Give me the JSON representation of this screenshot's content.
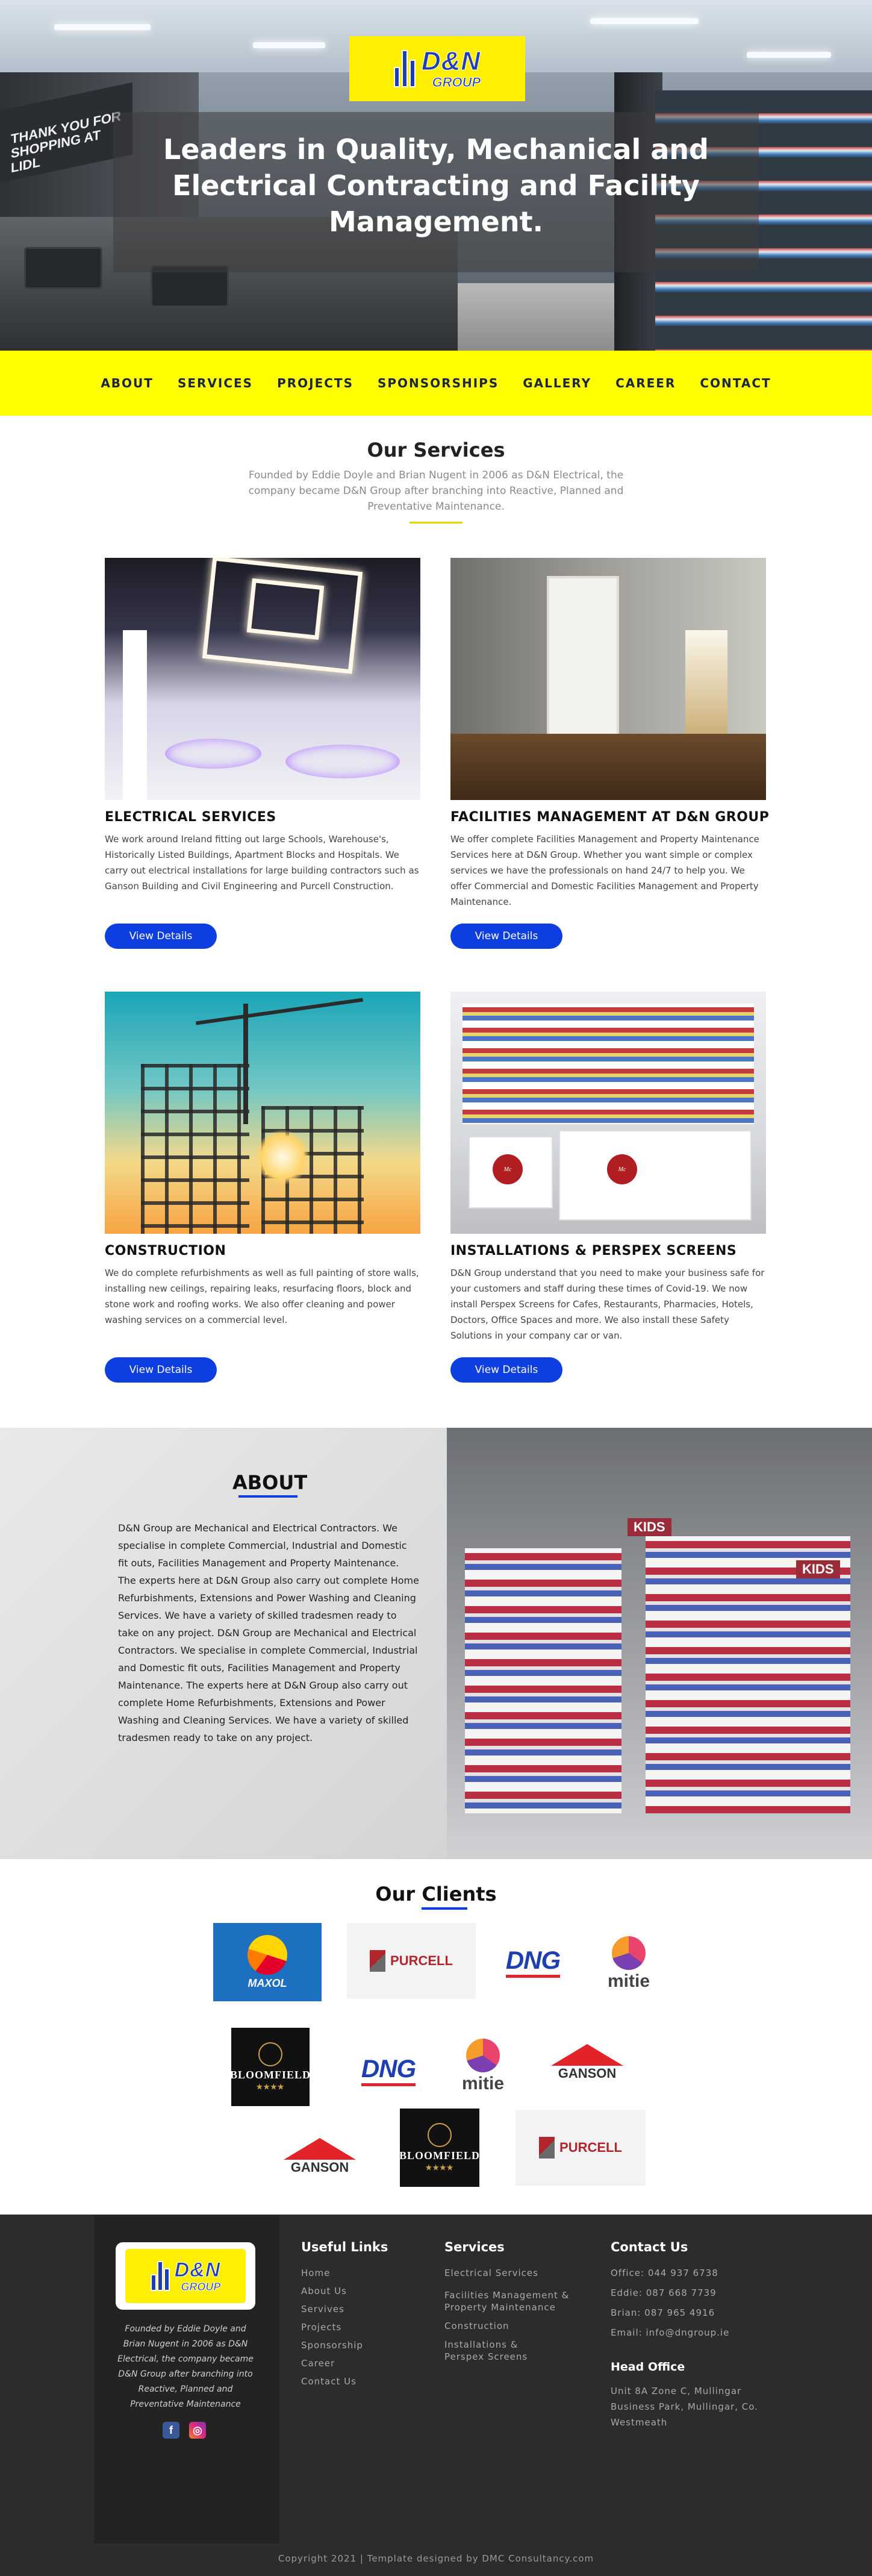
{
  "brand": {
    "logo_main": "D&N",
    "logo_sub": "GROUP",
    "accent": "#ffff00",
    "button_blue": "#0d3fe0"
  },
  "hero": {
    "title": "Leaders in Quality, Mechanical and Electrical Contracting and Facility Management.",
    "sign_text": "THANK YOU FOR SHOPPING AT LIDL"
  },
  "nav": {
    "items": [
      "ABOUT",
      "SERVICES",
      "PROJECTS",
      "SPONSORSHIPS",
      "GALLERY",
      "CAREER",
      "CONTACT"
    ]
  },
  "services": {
    "title": "Our Services",
    "intro": "Founded by Eddie Doyle and Brian Nugent in 2006 as D&N Electrical, the company became D&N Group after branching into Reactive, Planned and Preventative Maintenance.",
    "cards": [
      {
        "title": "ELECTRICAL SERVICES",
        "text": "We work around Ireland fitting out large Schools, Warehouse's, Historically Listed Buildings, Apartment Blocks and Hospitals. We carry out electrical installations for large building contractors such as Ganson Building and Civil Engineering and Purcell Construction.",
        "button": "View Details"
      },
      {
        "title": "FACILITIES MANAGEMENT AT D&N GROUP",
        "text": "We offer complete Facilities Management and Property Maintenance Services here at D&N Group. Whether you want simple or complex services we have the professionals on hand 24/7 to help you. We offer Commercial and Domestic Facilities Management and Property Maintenance.",
        "button": "View Details"
      },
      {
        "title": "CONSTRUCTION",
        "text": "We do complete refurbishments as well as full painting of store walls, installing new ceilings, repairing leaks, resurfacing floors, block and stone work and roofing works. We also offer cleaning and power washing services on a commercial level.",
        "button": "View Details"
      },
      {
        "title": "INSTALLATIONS & PERSPEX SCREENS",
        "text": "D&N Group understand that you need to make your business safe for your customers and staff during these times of Covid-19. We now install Perspex Screens for Cafes, Restaurants, Pharmacies, Hotels, Doctors, Office Spaces and more. We also install these Safety Solutions in your company car or van.",
        "button": "View Details"
      }
    ]
  },
  "about": {
    "title": "ABOUT",
    "text": "D&N Group are Mechanical and Electrical Contractors. We specialise in complete Commercial, Industrial and Domestic fit outs, Facilities Management and Property Maintenance. The experts here at D&N Group also carry out complete Home Refurbishments, Extensions and Power Washing and Cleaning Services. We have a variety of skilled tradesmen ready to take on any project. D&N Group are Mechanical and Electrical Contractors. We specialise in complete Commercial, Industrial and Domestic fit outs, Facilities Management and Property Maintenance. The experts here at D&N Group also carry out complete Home Refurbishments, Extensions and Power Washing and Cleaning Services. We have a variety of skilled tradesmen ready to take on any project.",
    "sign": "KIDS"
  },
  "clients": {
    "title": "Our Clients",
    "logos": {
      "maxol": "MAXOL",
      "purcell": "PURCELL",
      "dng": "DNG",
      "mitie": "mitie",
      "bloomfield": "BLOOMFIELD",
      "ganson": "GANSON",
      "bloom_stars": "★★★★"
    }
  },
  "footer": {
    "about": "Founded by Eddie Doyle and Brian Nugent in 2006 as D&N Electrical, the company became D&N Group after branching into Reactive, Planned and Preventative Maintenance",
    "social": {
      "facebook": "f",
      "instagram": "◎"
    },
    "useful_title": "Useful Links",
    "useful_links": [
      "Home",
      "About Us",
      "Servives",
      "Projects",
      "Sponsorship",
      "Career",
      "Contact Us"
    ],
    "services_title": "Services",
    "services_links": [
      "Electrical Services",
      "Facilities Management & Property Maintenance",
      "Construction",
      "Installations & Perspex Screens"
    ],
    "contact_title": "Contact Us",
    "office": "Office: 044 937 6738",
    "eddie": "Eddie: 087 668 7739",
    "brian": "Brian: 087 965 4916",
    "email": "Email: info@dngroup.ie",
    "head_office_title": "Head Office",
    "address": "Unit 8A Zone C, Mullingar Business Park, Mullingar, Co. Westmeath",
    "copyright": "Copyright 2021 | Template designed by DMC Consultancy.com"
  }
}
